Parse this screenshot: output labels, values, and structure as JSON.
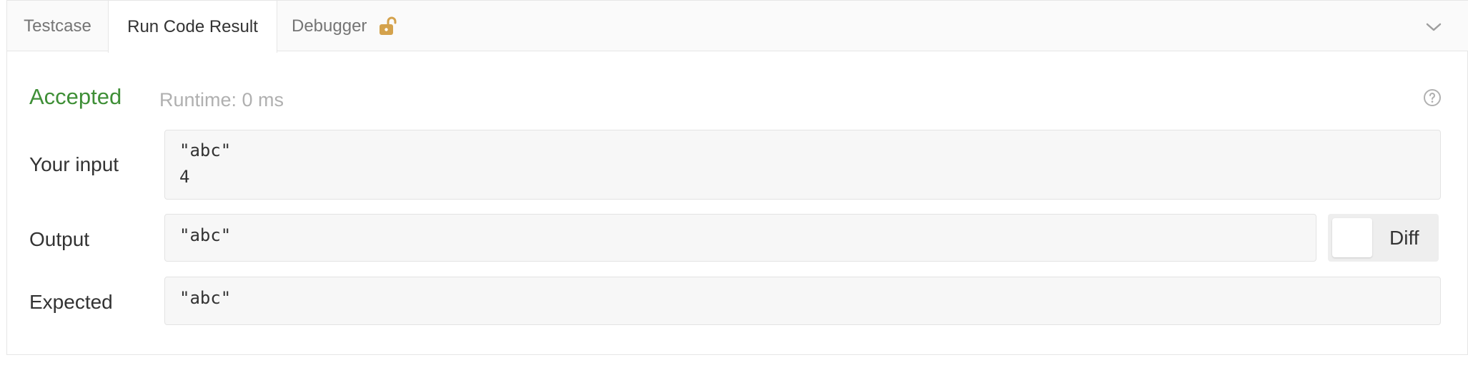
{
  "tabs": {
    "testcase": "Testcase",
    "result": "Run Code Result",
    "debugger": "Debugger"
  },
  "result": {
    "status": "Accepted",
    "runtime": "Runtime: 0 ms",
    "status_color": "#3f8f37"
  },
  "input": {
    "label": "Your input",
    "lines": [
      "\"abc\"",
      "4"
    ]
  },
  "output": {
    "label": "Output",
    "value": "\"abc\"",
    "diff_label": "Diff"
  },
  "expected": {
    "label": "Expected",
    "value": "\"abc\""
  },
  "icons": {
    "debugger_lock": "unlock-icon",
    "collapse": "chevron-down-icon",
    "help": "help-circle-icon"
  }
}
